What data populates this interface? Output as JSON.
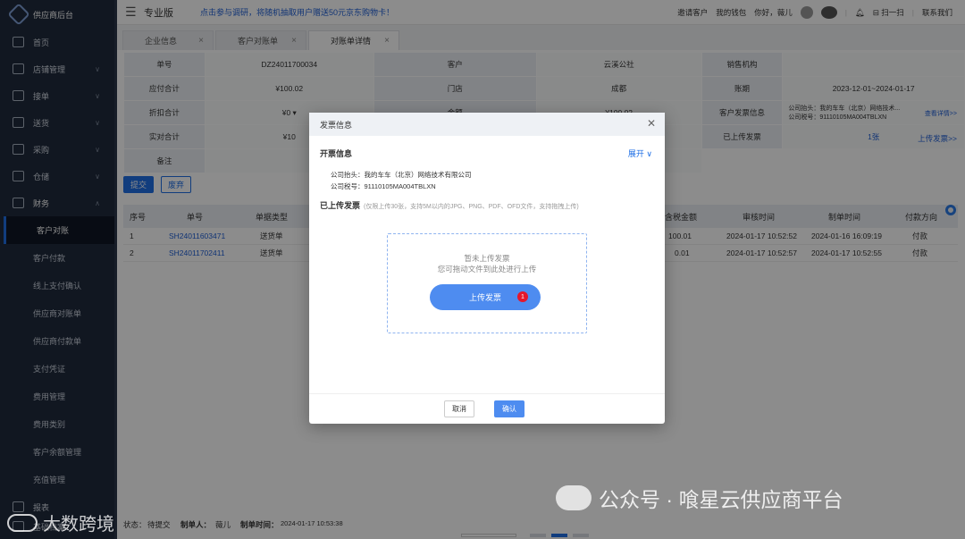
{
  "sidebar": {
    "brand": "供应商后台",
    "items": [
      {
        "label": "首页",
        "icon": "home-icon"
      },
      {
        "label": "店铺管理",
        "icon": "shop-icon"
      },
      {
        "label": "接单",
        "icon": "clipboard-icon"
      },
      {
        "label": "送货",
        "icon": "truck-icon"
      },
      {
        "label": "采购",
        "icon": "purchase-icon"
      },
      {
        "label": "仓储",
        "icon": "warehouse-icon"
      },
      {
        "label": "财务",
        "icon": "wallet-icon"
      }
    ],
    "finance_sub": [
      "客户对账",
      "客户付款",
      "线上支付确认",
      "供应商对账单",
      "供应商付款单",
      "支付凭证",
      "费用管理",
      "费用类别",
      "客户余额管理",
      "充值管理"
    ],
    "bottom": [
      "报表",
      "基础档案"
    ]
  },
  "topbar": {
    "edition": "专业版",
    "promo": "点击参与调研，将随机抽取用户赠送50元京东购物卡！",
    "invite": "邀请客户",
    "wallet": "我的钱包",
    "greeting": "你好，薇儿",
    "scan": "扫一扫",
    "contact": "联系我们"
  },
  "tabs": [
    "企业信息",
    "客户对账单",
    "对账单详情"
  ],
  "info": {
    "r1": [
      "单号",
      "DZ24011700034",
      "客户",
      "云溪公社",
      "销售机构",
      ""
    ],
    "r2": [
      "应付合计",
      "¥100.02",
      "门店",
      "成都",
      "账期",
      "2023-12-01~2024-01-17"
    ],
    "r3": [
      "折扣合计",
      "¥0 ▾",
      "金额",
      "¥100.02",
      "客户发票信息",
      "公司抬头：我的车车（北京）网络技术...",
      "公司税号：91110105MA004TBLXN",
      "查看详情>>"
    ],
    "r4": [
      "实对合计",
      "¥10",
      "",
      "",
      "已上传发票",
      "1张",
      "上传发票>>"
    ],
    "r5": [
      "备注",
      ""
    ]
  },
  "buttons": {
    "submit": "提交",
    "discard": "废弃"
  },
  "grid": {
    "headers": [
      "序号",
      "单号",
      "单据类型",
      "含税金额",
      "审核时间",
      "制单时间",
      "付款方向"
    ],
    "rows": [
      [
        "1",
        "SH24011603471",
        "送货单",
        "100.01",
        "2024-01-17 10:52:52",
        "2024-01-16 16:09:19",
        "付款"
      ],
      [
        "2",
        "SH24011702411",
        "送货单",
        "0.01",
        "2024-01-17 10:52:57",
        "2024-01-17 10:52:55",
        "付款"
      ]
    ]
  },
  "footer": {
    "status_label": "状态：",
    "status": "待提交",
    "creator_label": "制单人：",
    "creator": "薇儿",
    "time_label": "制单时间：",
    "time": "2024-01-17 10:53:38"
  },
  "modal": {
    "title": "发票信息",
    "section1": "开票信息",
    "expand": "展开 ∨",
    "company": "公司抬头：我的车车（北京）网络技术有限公司",
    "tax": "公司税号：91110105MA004TBLXN",
    "section2": "已上传发票",
    "hint": "(仅限上传30张，支持5M以内的JPG、PNG、PDF、OFD文件，支持拖拽上传)",
    "empty1": "暂未上传发票",
    "empty2": "您可拖动文件到此处进行上传",
    "upload": "上传发票",
    "badge": "1",
    "cancel": "取消",
    "ok": "确认"
  },
  "watermark": {
    "wechat": "公众号 · 喰星云供应商平台",
    "logo": "大数跨境"
  },
  "colors": {
    "accent": "#1f6fe5",
    "sidebar": "#1f2a3c",
    "badge": "#e5162c"
  }
}
